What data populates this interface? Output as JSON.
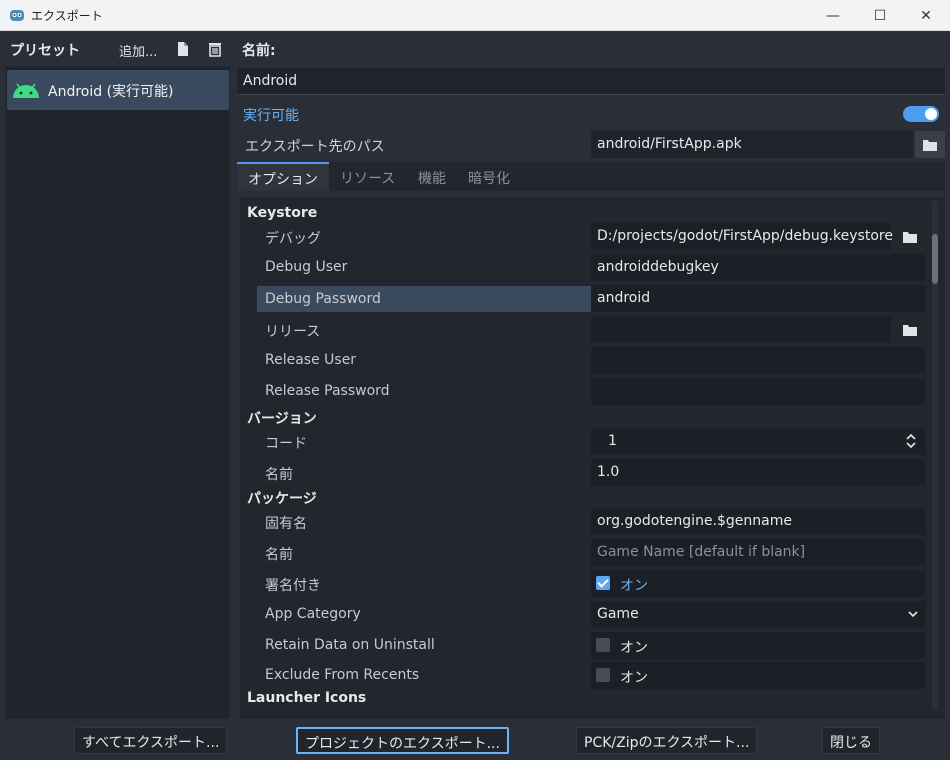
{
  "window": {
    "title": "エクスポート",
    "minimize": "—",
    "maximize": "☐",
    "close": "✕"
  },
  "presets": {
    "header": "プリセット",
    "add_label": "追加...",
    "items": [
      {
        "label": "Android (実行可能)",
        "icon": "android-icon"
      }
    ]
  },
  "preset_form": {
    "name_label": "名前:",
    "name_value": "Android",
    "runnable_label": "実行可能",
    "runnable_on": true,
    "export_path_label": "エクスポート先のパス",
    "export_path_value": "android/FirstApp.apk"
  },
  "tabs": [
    "オプション",
    "リソース",
    "機能",
    "暗号化"
  ],
  "options": {
    "keystore": {
      "section": "Keystore",
      "debug_label": "デバッグ",
      "debug_value": "D:/projects/godot/FirstApp/debug.keystore",
      "debug_user_label": "Debug User",
      "debug_user_value": "androiddebugkey",
      "debug_password_label": "Debug Password",
      "debug_password_value": "android",
      "release_label": "リリース",
      "release_value": "",
      "release_user_label": "Release User",
      "release_user_value": "",
      "release_password_label": "Release Password",
      "release_password_value": ""
    },
    "version": {
      "section": "バージョン",
      "code_label": "コード",
      "code_value": "1",
      "name_label": "名前",
      "name_value": "1.0"
    },
    "package": {
      "section": "パッケージ",
      "unique_name_label": "固有名",
      "unique_name_value": "org.godotengine.$genname",
      "name_label": "名前",
      "name_placeholder": "Game Name [default if blank]",
      "signed_label": "署名付き",
      "signed_text": "オン",
      "signed_checked": true,
      "app_category_label": "App Category",
      "app_category_value": "Game",
      "retain_label": "Retain Data on Uninstall",
      "retain_text": "オン",
      "retain_checked": false,
      "exclude_label": "Exclude From Recents",
      "exclude_text": "オン",
      "exclude_checked": false
    },
    "launcher_icons": {
      "section": "Launcher Icons"
    }
  },
  "footer": {
    "export_all": "すべてエクスポート...",
    "export_project": "プロジェクトのエクスポート...",
    "export_pck": "PCK/Zipのエクスポート...",
    "close": "閉じる"
  },
  "colors": {
    "accent": "#4c9df0",
    "selection": "#3a4a5e",
    "android_green": "#3ddc84"
  }
}
